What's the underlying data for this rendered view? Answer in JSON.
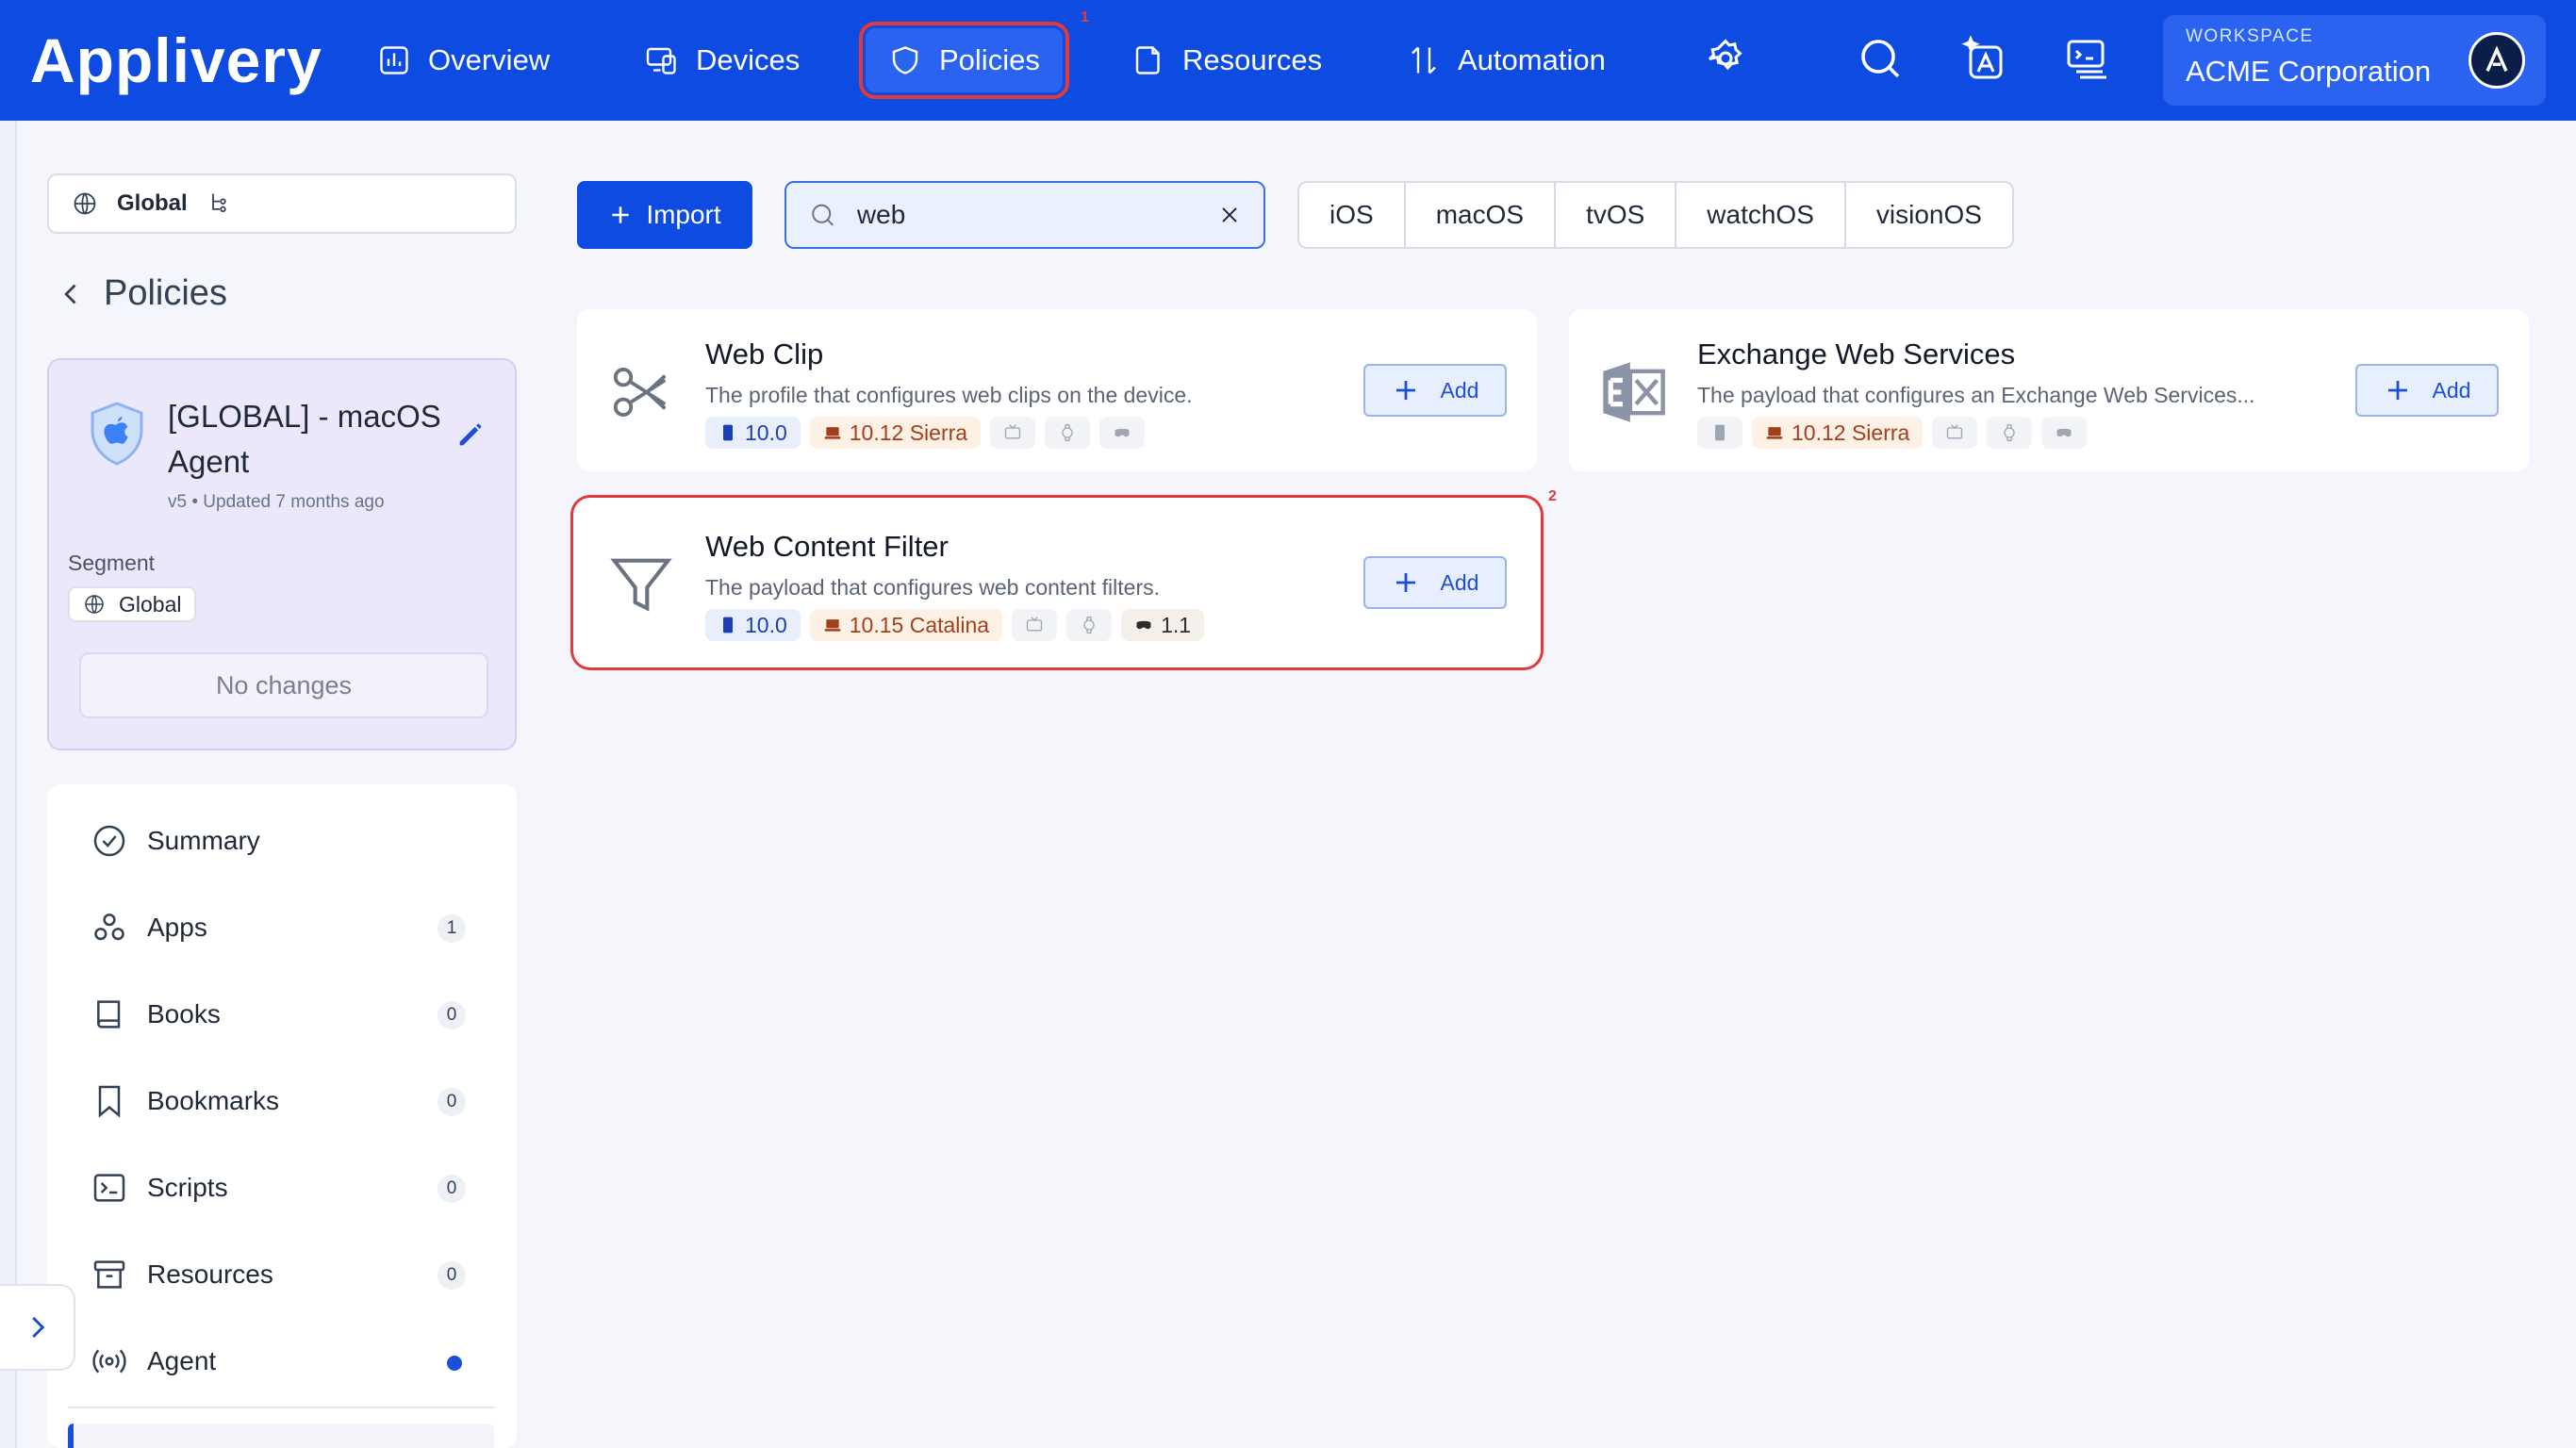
{
  "app": {
    "logo": "Applivery"
  },
  "nav": {
    "items": [
      {
        "label": "Overview",
        "icon": "chart-icon"
      },
      {
        "label": "Devices",
        "icon": "devices-icon"
      },
      {
        "label": "Policies",
        "icon": "shield-icon",
        "active": true
      },
      {
        "label": "Resources",
        "icon": "resources-icon"
      },
      {
        "label": "Automation",
        "icon": "automation-icon"
      }
    ],
    "active_marker": "1"
  },
  "workspace": {
    "label": "WORKSPACE",
    "name": "ACME Corporation"
  },
  "sidebar": {
    "scope": "Global",
    "back_label": "Policies",
    "policy": {
      "name": "[GLOBAL] - macOS Agent",
      "meta": "v5 • Updated 7 months ago",
      "segment_label": "Segment",
      "segment_value": "Global",
      "no_changes": "No changes"
    },
    "menu": [
      {
        "label": "Summary",
        "count": null
      },
      {
        "label": "Apps",
        "count": "1"
      },
      {
        "label": "Books",
        "count": "0"
      },
      {
        "label": "Bookmarks",
        "count": "0"
      },
      {
        "label": "Scripts",
        "count": "0"
      },
      {
        "label": "Resources",
        "count": "0"
      },
      {
        "label": "Agent",
        "count": null,
        "dot": true
      }
    ]
  },
  "toolbar": {
    "import_label": "Import",
    "search_value": "web",
    "os_filters": [
      "iOS",
      "macOS",
      "tvOS",
      "watchOS",
      "visionOS"
    ]
  },
  "cards": [
    {
      "title": "Web Clip",
      "description": "The profile that configures web clips on the device.",
      "ios": "10.0",
      "macos": "10.12 Sierra",
      "visionos": "",
      "add_label": "Add"
    },
    {
      "title": "Exchange Web Services",
      "description": "The payload that configures an Exchange Web Services...",
      "ios": "",
      "macos": "10.12 Sierra",
      "visionos": "",
      "add_label": "Add"
    },
    {
      "title": "Web Content Filter",
      "description": "The payload that configures web content filters.",
      "ios": "10.0",
      "macos": "10.15 Catalina",
      "visionos": "1.1",
      "add_label": "Add",
      "marker": "2"
    }
  ],
  "colors": {
    "brand": "#0e4be0",
    "highlight": "#e23a3a"
  }
}
